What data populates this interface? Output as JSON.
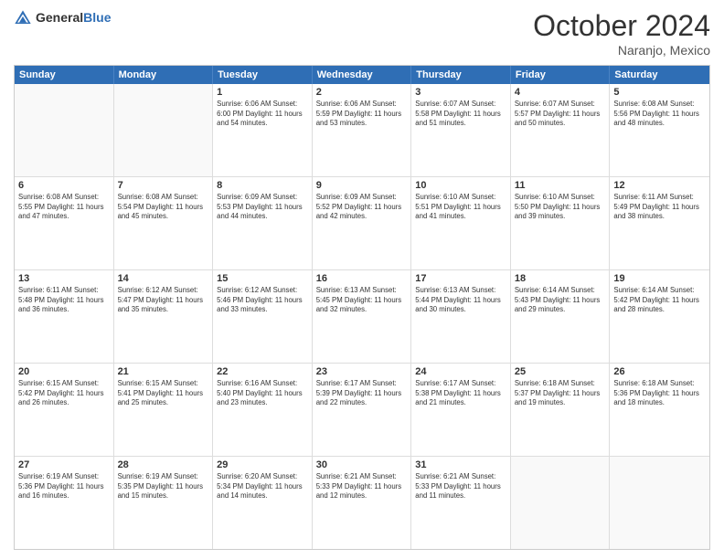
{
  "header": {
    "logo_general": "General",
    "logo_blue": "Blue",
    "title": "October 2024",
    "location": "Naranjo, Mexico"
  },
  "days_of_week": [
    "Sunday",
    "Monday",
    "Tuesday",
    "Wednesday",
    "Thursday",
    "Friday",
    "Saturday"
  ],
  "weeks": [
    [
      {
        "day": "",
        "info": ""
      },
      {
        "day": "",
        "info": ""
      },
      {
        "day": "1",
        "info": "Sunrise: 6:06 AM\nSunset: 6:00 PM\nDaylight: 11 hours and 54 minutes."
      },
      {
        "day": "2",
        "info": "Sunrise: 6:06 AM\nSunset: 5:59 PM\nDaylight: 11 hours and 53 minutes."
      },
      {
        "day": "3",
        "info": "Sunrise: 6:07 AM\nSunset: 5:58 PM\nDaylight: 11 hours and 51 minutes."
      },
      {
        "day": "4",
        "info": "Sunrise: 6:07 AM\nSunset: 5:57 PM\nDaylight: 11 hours and 50 minutes."
      },
      {
        "day": "5",
        "info": "Sunrise: 6:08 AM\nSunset: 5:56 PM\nDaylight: 11 hours and 48 minutes."
      }
    ],
    [
      {
        "day": "6",
        "info": "Sunrise: 6:08 AM\nSunset: 5:55 PM\nDaylight: 11 hours and 47 minutes."
      },
      {
        "day": "7",
        "info": "Sunrise: 6:08 AM\nSunset: 5:54 PM\nDaylight: 11 hours and 45 minutes."
      },
      {
        "day": "8",
        "info": "Sunrise: 6:09 AM\nSunset: 5:53 PM\nDaylight: 11 hours and 44 minutes."
      },
      {
        "day": "9",
        "info": "Sunrise: 6:09 AM\nSunset: 5:52 PM\nDaylight: 11 hours and 42 minutes."
      },
      {
        "day": "10",
        "info": "Sunrise: 6:10 AM\nSunset: 5:51 PM\nDaylight: 11 hours and 41 minutes."
      },
      {
        "day": "11",
        "info": "Sunrise: 6:10 AM\nSunset: 5:50 PM\nDaylight: 11 hours and 39 minutes."
      },
      {
        "day": "12",
        "info": "Sunrise: 6:11 AM\nSunset: 5:49 PM\nDaylight: 11 hours and 38 minutes."
      }
    ],
    [
      {
        "day": "13",
        "info": "Sunrise: 6:11 AM\nSunset: 5:48 PM\nDaylight: 11 hours and 36 minutes."
      },
      {
        "day": "14",
        "info": "Sunrise: 6:12 AM\nSunset: 5:47 PM\nDaylight: 11 hours and 35 minutes."
      },
      {
        "day": "15",
        "info": "Sunrise: 6:12 AM\nSunset: 5:46 PM\nDaylight: 11 hours and 33 minutes."
      },
      {
        "day": "16",
        "info": "Sunrise: 6:13 AM\nSunset: 5:45 PM\nDaylight: 11 hours and 32 minutes."
      },
      {
        "day": "17",
        "info": "Sunrise: 6:13 AM\nSunset: 5:44 PM\nDaylight: 11 hours and 30 minutes."
      },
      {
        "day": "18",
        "info": "Sunrise: 6:14 AM\nSunset: 5:43 PM\nDaylight: 11 hours and 29 minutes."
      },
      {
        "day": "19",
        "info": "Sunrise: 6:14 AM\nSunset: 5:42 PM\nDaylight: 11 hours and 28 minutes."
      }
    ],
    [
      {
        "day": "20",
        "info": "Sunrise: 6:15 AM\nSunset: 5:42 PM\nDaylight: 11 hours and 26 minutes."
      },
      {
        "day": "21",
        "info": "Sunrise: 6:15 AM\nSunset: 5:41 PM\nDaylight: 11 hours and 25 minutes."
      },
      {
        "day": "22",
        "info": "Sunrise: 6:16 AM\nSunset: 5:40 PM\nDaylight: 11 hours and 23 minutes."
      },
      {
        "day": "23",
        "info": "Sunrise: 6:17 AM\nSunset: 5:39 PM\nDaylight: 11 hours and 22 minutes."
      },
      {
        "day": "24",
        "info": "Sunrise: 6:17 AM\nSunset: 5:38 PM\nDaylight: 11 hours and 21 minutes."
      },
      {
        "day": "25",
        "info": "Sunrise: 6:18 AM\nSunset: 5:37 PM\nDaylight: 11 hours and 19 minutes."
      },
      {
        "day": "26",
        "info": "Sunrise: 6:18 AM\nSunset: 5:36 PM\nDaylight: 11 hours and 18 minutes."
      }
    ],
    [
      {
        "day": "27",
        "info": "Sunrise: 6:19 AM\nSunset: 5:36 PM\nDaylight: 11 hours and 16 minutes."
      },
      {
        "day": "28",
        "info": "Sunrise: 6:19 AM\nSunset: 5:35 PM\nDaylight: 11 hours and 15 minutes."
      },
      {
        "day": "29",
        "info": "Sunrise: 6:20 AM\nSunset: 5:34 PM\nDaylight: 11 hours and 14 minutes."
      },
      {
        "day": "30",
        "info": "Sunrise: 6:21 AM\nSunset: 5:33 PM\nDaylight: 11 hours and 12 minutes."
      },
      {
        "day": "31",
        "info": "Sunrise: 6:21 AM\nSunset: 5:33 PM\nDaylight: 11 hours and 11 minutes."
      },
      {
        "day": "",
        "info": ""
      },
      {
        "day": "",
        "info": ""
      }
    ]
  ]
}
